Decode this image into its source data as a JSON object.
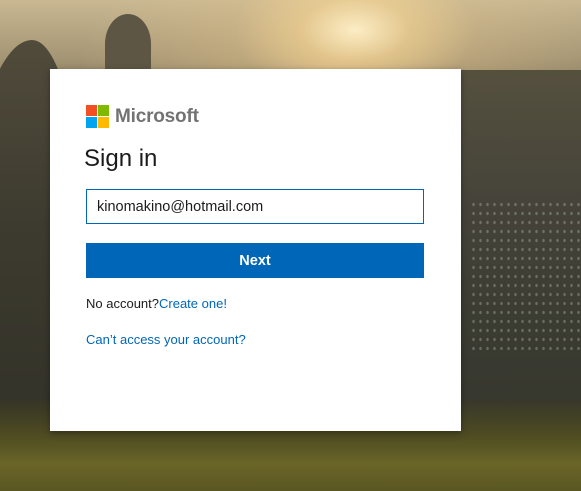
{
  "brand": {
    "name": "Microsoft",
    "colors": {
      "red": "#f25022",
      "green": "#7fba00",
      "blue": "#00a4ef",
      "yellow": "#ffb900"
    }
  },
  "signin": {
    "title": "Sign in",
    "email_value": "kinomakino@hotmail.com",
    "next_label": "Next",
    "no_account_text": "No account?",
    "create_link": "Create one!",
    "cant_access_link": "Can’t access your account?"
  },
  "theme": {
    "accent": "#0067b8",
    "card_bg": "#ffffff"
  }
}
